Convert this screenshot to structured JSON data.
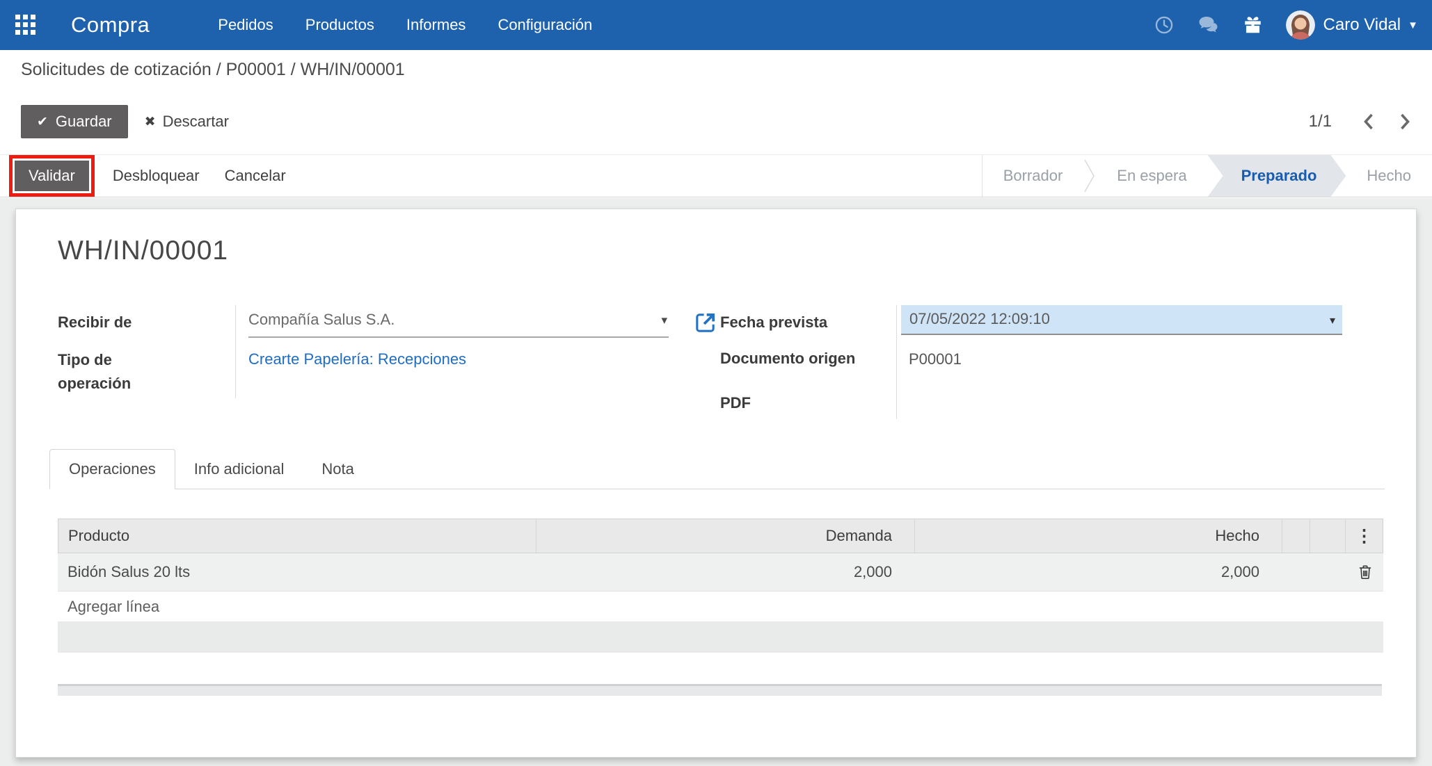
{
  "navbar": {
    "brand": "Compra",
    "menu": [
      "Pedidos",
      "Productos",
      "Informes",
      "Configuración"
    ],
    "user_name": "Caro Vidal"
  },
  "breadcrumb": "Solicitudes de cotización / P00001 / WH/IN/00001",
  "action_bar": {
    "save_label": "Guardar",
    "discard_label": "Descartar",
    "pager": "1/1"
  },
  "statusbar": {
    "validate_label": "Validar",
    "unlock_label": "Desbloquear",
    "cancel_label": "Cancelar",
    "steps": [
      {
        "label": "Borrador",
        "active": false
      },
      {
        "label": "En espera",
        "active": false
      },
      {
        "label": "Preparado",
        "active": true
      },
      {
        "label": "Hecho",
        "active": false
      }
    ]
  },
  "form": {
    "title": "WH/IN/00001",
    "fields": {
      "recibir_de": {
        "label": "Recibir de",
        "value": "Compañía Salus S.A."
      },
      "tipo_operacion": {
        "label": "Tipo de operación",
        "value": "Crearte Papelería: Recepciones"
      },
      "fecha_prevista": {
        "label": "Fecha prevista",
        "value": "07/05/2022 12:09:10"
      },
      "documento_origen": {
        "label": "Documento origen",
        "value": "P00001"
      },
      "pdf": {
        "label": "PDF"
      }
    }
  },
  "tabs": [
    {
      "label": "Operaciones",
      "active": true
    },
    {
      "label": "Info adicional",
      "active": false
    },
    {
      "label": "Nota",
      "active": false
    }
  ],
  "operations_table": {
    "columns": {
      "producto": "Producto",
      "demanda": "Demanda",
      "hecho": "Hecho"
    },
    "rows": [
      {
        "producto": "Bidón Salus 20 lts",
        "demanda": "2,000",
        "hecho": "2,000"
      }
    ],
    "add_line_label": "Agregar línea"
  },
  "colors": {
    "navbar_bg": "#1e61ad",
    "link_blue": "#1f6dc2",
    "selected_field_bg": "#cfe4f6",
    "step_active_bg": "#e2e5ea",
    "step_active_text": "#1a5cac",
    "annotation_red": "#ee1b10",
    "dark_button_bg": "#615e5f"
  }
}
